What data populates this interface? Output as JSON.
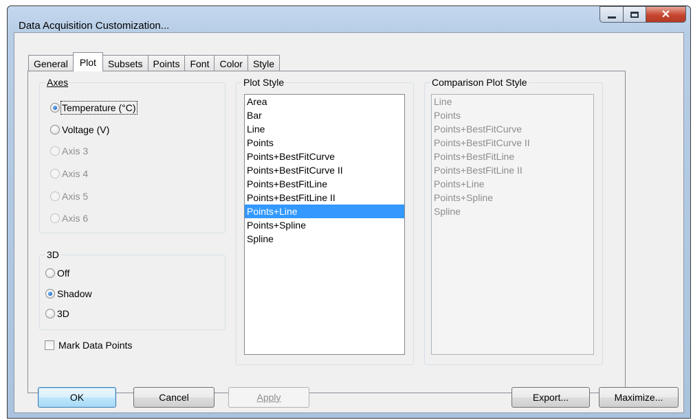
{
  "window": {
    "title": "Data Acquisition Customization..."
  },
  "tabs": [
    "General",
    "Plot",
    "Subsets",
    "Points",
    "Font",
    "Color",
    "Style"
  ],
  "axes": {
    "label": "Axes",
    "options": [
      {
        "label": "Temperature (°C)",
        "checked": true,
        "enabled": true
      },
      {
        "label": "Voltage (V)",
        "checked": false,
        "enabled": true
      },
      {
        "label": "Axis 3",
        "checked": false,
        "enabled": false
      },
      {
        "label": "Axis 4",
        "checked": false,
        "enabled": false
      },
      {
        "label": "Axis 5",
        "checked": false,
        "enabled": false
      },
      {
        "label": "Axis 6",
        "checked": false,
        "enabled": false
      }
    ]
  },
  "three_d": {
    "label": "3D",
    "options": [
      {
        "label": "Off",
        "checked": false
      },
      {
        "label": "Shadow",
        "checked": true
      },
      {
        "label": "3D",
        "checked": false
      }
    ]
  },
  "mark_data_points": {
    "label": "Mark Data Points",
    "checked": false
  },
  "plot_style": {
    "label": "Plot Style",
    "items": [
      "Area",
      "Bar",
      "Line",
      "Points",
      "Points+BestFitCurve",
      "Points+BestFitCurve II",
      "Points+BestFitLine",
      "Points+BestFitLine II",
      "Points+Line",
      "Points+Spline",
      "Spline"
    ],
    "selected": "Points+Line"
  },
  "comparison_plot_style": {
    "label": "Comparison Plot Style",
    "items": [
      "Line",
      "Points",
      "Points+BestFitCurve",
      "Points+BestFitCurve II",
      "Points+BestFitLine",
      "Points+BestFitLine II",
      "Points+Line",
      "Points+Spline",
      "Spline"
    ]
  },
  "buttons": {
    "ok": "OK",
    "cancel": "Cancel",
    "apply": "Apply",
    "export": "Export...",
    "maximize": "Maximize..."
  },
  "colors": {
    "selection": "#3399ff",
    "close_button": "#c6462f",
    "window_frame": "#b9d1ea"
  }
}
